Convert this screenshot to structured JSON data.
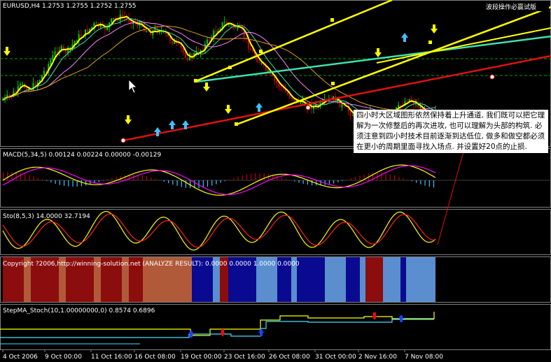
{
  "header": {
    "symbol_info": "EURUSD,H4 1.2753 1.2755 1.2752 1.2755",
    "top_right": "波段操作必赢试版"
  },
  "panels": {
    "macd_label": "MACD(5,34,5) 0.00124 0.00224 0.00000 -0.00129",
    "sto_label": "Sto(8,5,3) 14.0000 32.7194",
    "analyze_label": "Copyright ?2006,http://winning-solution.net (ANALYZE RESULT): 0.0000 0.0000 1.0000 0.0000",
    "stepma_label": "StepMA_Stoch(10,1.00000000,0) 0.8574 0.6896"
  },
  "annotation": "四小时大区域图形依然保持着上升通道, 我们既可以把它理解为一次修整后的再次进攻, 也可以理解为头部的构筑. 必须注意到四小时技术目前逐渐到达低位, 做多和做空都必须在更小的周期里面寻找入场点. 并设置好20点的止损.",
  "chart_data": {
    "type": "candlestick",
    "instrument": "EURUSD",
    "timeframe": "H4",
    "x_ticks": [
      "4 Oct 2006",
      "9 Oct 00:00",
      "11 Oct 16:00",
      "16 Oct 08:00",
      "19 Oct 00:00",
      "23 Oct 16:00",
      "26 Oct 08:00",
      "31 Oct 00:00",
      "2 Nov 16:00",
      "7 Nov 08:00"
    ],
    "price_path": [
      52,
      60,
      75,
      70,
      85,
      110,
      135,
      128,
      150,
      160,
      172,
      165,
      180,
      185,
      178,
      170,
      160,
      165,
      150,
      140,
      120,
      125,
      140,
      160,
      175,
      170,
      160,
      130,
      110,
      90,
      75,
      60,
      50,
      45,
      40,
      48,
      55,
      40,
      30,
      25,
      35,
      20,
      28,
      40,
      55,
      45,
      30,
      40
    ],
    "analyze_blocks": [
      "red",
      "tan",
      "red",
      "tan",
      "red",
      "tan",
      "red",
      "tan",
      "red",
      "tan",
      "blue",
      "lightblue",
      "red",
      "blue",
      "lightblue",
      "blue",
      "lightblue",
      "blue",
      "lightblue",
      "blue",
      "lightblue",
      "red",
      "lightblue",
      "blue",
      "lightblue"
    ]
  },
  "colors": {
    "bull": "#00d000",
    "bear": "#c00000",
    "channel": "#ffff00",
    "trend_red": "#e01010",
    "trend_teal": "#40e0b0",
    "macd_signal": "#ff00ff",
    "macd_hist_up": "#c00000",
    "macd_hist_dn": "#40c0ff",
    "sto_main": "#ffff00",
    "sto_signal": "#ff2020",
    "analyze_red": "#8b0d0d",
    "analyze_tan": "#b05a3a",
    "analyze_blue": "#0a0a90",
    "analyze_lightblue": "#5a8ecf"
  }
}
